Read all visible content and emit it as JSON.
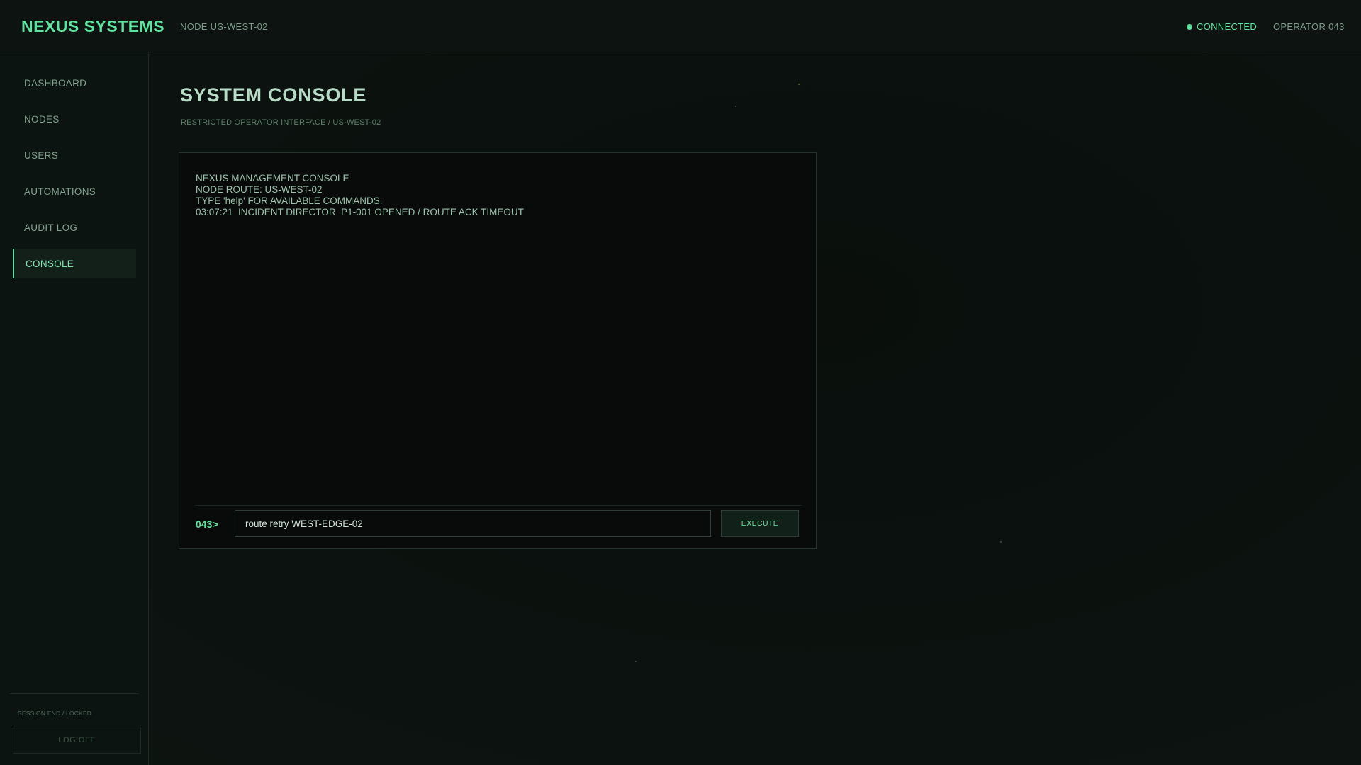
{
  "header": {
    "brand": "NEXUS SYSTEMS",
    "node": "NODE US-WEST-02",
    "status": "CONNECTED",
    "operator": "OPERATOR 043"
  },
  "sidebar": {
    "items": [
      {
        "label": "DASHBOARD"
      },
      {
        "label": "NODES"
      },
      {
        "label": "USERS"
      },
      {
        "label": "AUTOMATIONS"
      },
      {
        "label": "AUDIT LOG"
      },
      {
        "label": "CONSOLE",
        "active": true
      }
    ],
    "session_label": "SESSION END / LOCKED",
    "logoff_label": "LOG OFF"
  },
  "main": {
    "title": "SYSTEM CONSOLE",
    "subtitle": "RESTRICTED OPERATOR INTERFACE / US-WEST-02"
  },
  "console": {
    "lines": [
      "NEXUS MANAGEMENT CONSOLE",
      "NODE ROUTE: US-WEST-02",
      "TYPE 'help' FOR AVAILABLE COMMANDS.",
      "03:07:21  INCIDENT DIRECTOR  P1-001 OPENED / ROUTE ACK TIMEOUT"
    ],
    "prompt": "043>",
    "input_value": "route retry WEST-EDGE-02",
    "execute_label": "EXECUTE"
  },
  "colors": {
    "accent": "#5ee3a0",
    "background": "#0b110e",
    "console_bg": "#080b09"
  }
}
